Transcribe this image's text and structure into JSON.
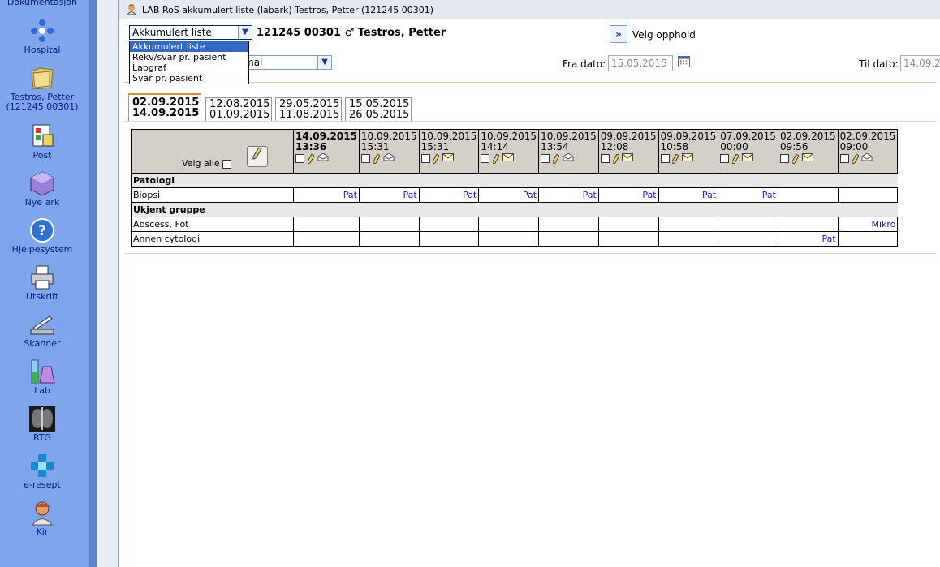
{
  "sidebar": {
    "top_label": "Dokumentasjon",
    "items": [
      {
        "label": "Hospital",
        "icon": "hospital-icon"
      },
      {
        "label": "Testros, Petter\n(121245 00301)",
        "line1": "Testros, Petter",
        "line2": "(121245 00301)",
        "icon": "patient-folder-icon"
      },
      {
        "label": "Post",
        "icon": "post-icon"
      },
      {
        "label": "Nye ark",
        "icon": "new-sheet-icon"
      },
      {
        "label": "Hjelpesystem",
        "icon": "help-icon"
      },
      {
        "label": "Utskrift",
        "icon": "printer-icon"
      },
      {
        "label": "Skanner",
        "icon": "scanner-icon"
      },
      {
        "label": "Lab",
        "icon": "lab-icon"
      },
      {
        "label": "RTG",
        "icon": "xray-icon"
      },
      {
        "label": "e-resept",
        "icon": "e-prescription-icon"
      },
      {
        "label": "Kir",
        "icon": "surgeon-icon"
      }
    ]
  },
  "window": {
    "title": "LAB RoS akkumulert liste (labark)  Testros, Petter  (121245 00301)"
  },
  "header": {
    "view_selected": "Akkumulert liste",
    "view_options": [
      "Akkumulert liste",
      "Rekv/svar pr. pasient",
      "Labgraf",
      "Svar pr. pasient"
    ],
    "patient_id": "121245 00301",
    "gender_symbol": "♂",
    "patient_name": "Testros, Petter",
    "opphold_button": "»",
    "opphold_label": "Velg opphold",
    "type_select_value": "mal",
    "fra_label": "Fra dato:",
    "fra_value": "15.05.2015",
    "til_label": "Til dato:",
    "til_value": "14.09.2"
  },
  "date_tabs": [
    {
      "from": "02.09.2015",
      "to": "14.09.2015",
      "active": true
    },
    {
      "from": "12.08.2015",
      "to": "01.09.2015",
      "active": false
    },
    {
      "from": "29.05.2015",
      "to": "11.08.2015",
      "active": false
    },
    {
      "from": "15.05.2015",
      "to": "26.05.2015",
      "active": false
    }
  ],
  "grid": {
    "select_all_label": "Velg alle",
    "columns": [
      {
        "date": "14.09.2015",
        "time": "13:36",
        "envelope": "open"
      },
      {
        "date": "10.09.2015",
        "time": "15:31",
        "envelope": "open"
      },
      {
        "date": "10.09.2015",
        "time": "15:31",
        "envelope": "closed"
      },
      {
        "date": "10.09.2015",
        "time": "14:14",
        "envelope": "closed"
      },
      {
        "date": "10.09.2015",
        "time": "13:54",
        "envelope": "open"
      },
      {
        "date": "09.09.2015",
        "time": "12:08",
        "envelope": "closed"
      },
      {
        "date": "09.09.2015",
        "time": "10:58",
        "envelope": "closed"
      },
      {
        "date": "07.09.2015",
        "time": "00:00",
        "envelope": "closed"
      },
      {
        "date": "02.09.2015",
        "time": "09:56",
        "envelope": "closed"
      },
      {
        "date": "02.09.2015",
        "time": "09:00",
        "envelope": "open"
      }
    ],
    "groups": [
      {
        "name": "Patologi",
        "rows": [
          {
            "label": "Biopsi",
            "cells": [
              "Pat",
              "Pat",
              "Pat",
              "Pat",
              "Pat",
              "Pat",
              "Pat",
              "Pat",
              "",
              ""
            ]
          }
        ]
      },
      {
        "name": "Ukjent gruppe",
        "rows": [
          {
            "label": "Abscess, Fot",
            "cells": [
              "",
              "",
              "",
              "",
              "",
              "",
              "",
              "",
              "",
              "Mikro"
            ]
          },
          {
            "label": "Annen cytologi",
            "cells": [
              "",
              "",
              "",
              "",
              "",
              "",
              "",
              "",
              "Pat",
              ""
            ]
          }
        ]
      }
    ]
  },
  "colors": {
    "sidebar_bg": "#7fa6ec",
    "link_blue": "#1a1ab4",
    "header_gray": "#d4d0c8",
    "active_tab_accent": "#e68b2c",
    "selection_blue": "#316ac5"
  }
}
